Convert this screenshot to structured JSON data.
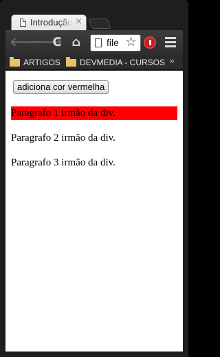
{
  "browser": {
    "tab_title": "Introdução",
    "tab_close": "×",
    "url": "file",
    "nav": {
      "back": "🡐",
      "forward": "🡒",
      "reload": "C",
      "home": "⌂"
    },
    "bookmarks": [
      {
        "label": "ARTIGOS"
      },
      {
        "label": "DEVMEDIA - CURSOS"
      }
    ],
    "bookmarks_more": "»"
  },
  "page": {
    "button_label": "adiciona cor vermelha",
    "paragraphs": [
      {
        "text": "Paragrafo 1 irmão da div.",
        "highlight_color": "#ff0000"
      },
      {
        "text": "Paragrafo 2 irmão da div."
      },
      {
        "text": "Paragrafo 3 irmão da div."
      }
    ]
  }
}
